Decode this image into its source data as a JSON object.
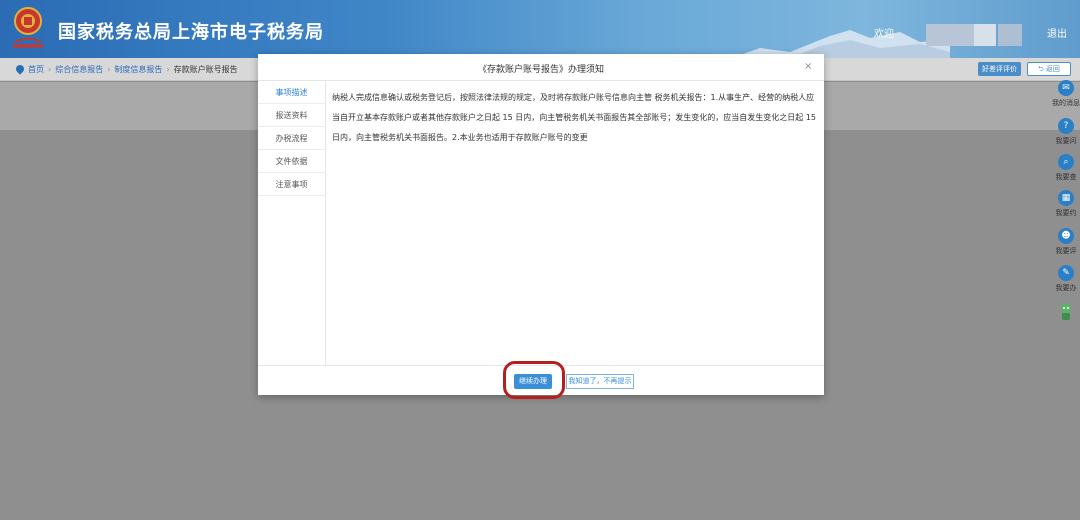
{
  "header": {
    "title": "国家税务总局上海市电子税务局",
    "welcome": "欢迎",
    "logout": "退出",
    "brand_color": "#2b6cb5"
  },
  "breadcrumb": {
    "home": "首页",
    "level1": "综合信息报告",
    "level2": "制度信息报告",
    "current": "存款账户账号报告"
  },
  "toolbar": {
    "rating_label": "好差评评价",
    "back_label": "返回"
  },
  "right_sidebar": [
    {
      "label": "我的消息",
      "icon": "message-icon"
    },
    {
      "label": "我要问",
      "icon": "question-icon"
    },
    {
      "label": "我要查",
      "icon": "search-icon"
    },
    {
      "label": "我要约",
      "icon": "calendar-icon"
    },
    {
      "label": "我要评",
      "icon": "rate-icon"
    },
    {
      "label": "我要办",
      "icon": "edit-icon"
    }
  ],
  "modal": {
    "title": "《存款账户账号报告》办理须知",
    "close": "×",
    "nav": [
      "事项描述",
      "报送资料",
      "办税流程",
      "文件依据",
      "注意事项"
    ],
    "active_index": 0,
    "body": "纳税人完成信息确认或税务登记后，按照法律法规的规定，及时将存款账户账号信息向主管 税务机关报告：1.从事生产、经营的纳税人应当自开立基本存款账户或者其他存款账户之日起 15 日内，向主管税务机关书面报告其全部账号；发生变化的，应当自发生变化之日起 15 日内，向主管税务机关书面报告。2.本业务也适用于存款账户账号的变更",
    "continue_label": "继续办理",
    "known_label": "我知道了，不再提示",
    "highlight_color": "#b3201e"
  }
}
